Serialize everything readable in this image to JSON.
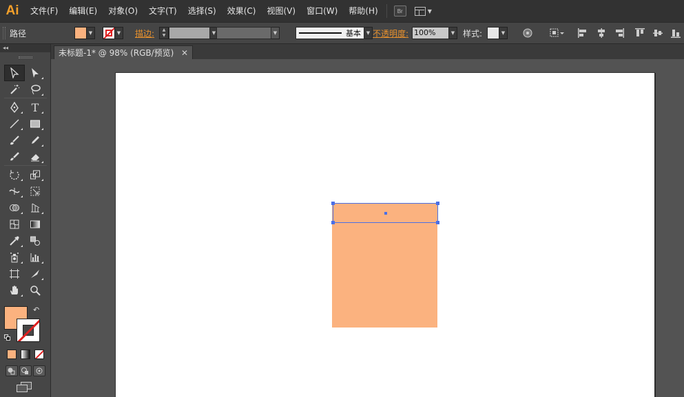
{
  "app": {
    "logo": "Ai"
  },
  "menu": {
    "items": [
      "文件(F)",
      "编辑(E)",
      "对象(O)",
      "文字(T)",
      "选择(S)",
      "效果(C)",
      "视图(V)",
      "窗口(W)",
      "帮助(H)"
    ],
    "bridge_label": "Br"
  },
  "control": {
    "object_type": "路径",
    "fill_color": "#fbb27f",
    "stroke_label": "描边",
    "stroke_profile_label": "基本",
    "opacity_label": "不透明度",
    "opacity_value": "100%",
    "style_label": "样式"
  },
  "document": {
    "tab_title": "未标题-1* @ 98% (RGB/预览)",
    "close_glyph": "✕"
  },
  "canvas": {
    "artboard_color": "#ffffff",
    "shape_fill": "#fbb27f",
    "selection_color": "#4a6fe6"
  },
  "toolbox": {
    "collapse_glyph": "◂◂",
    "fill_color": "#fbb27f",
    "stroke_state": "none"
  }
}
